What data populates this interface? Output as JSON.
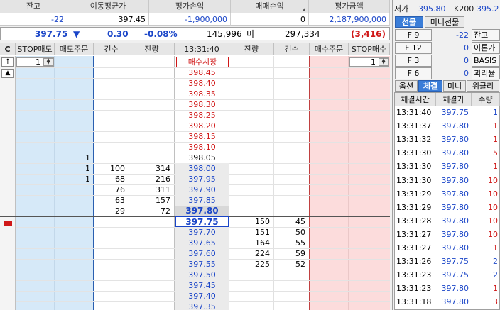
{
  "summary": {
    "headers": [
      "잔고",
      "이동평균가",
      "평가손익",
      "매매손익",
      "평가금액"
    ],
    "values": [
      "-22",
      "397.45",
      "-1,900,000",
      "0",
      "2,187,900,000"
    ]
  },
  "price_bar": {
    "price": "397.75",
    "arrow": "▼",
    "change": "0.30",
    "rate": "-0.08%",
    "volume": "145,996",
    "mi_label": "미",
    "open_int": "297,334",
    "diff": "(3,416)"
  },
  "orderbook": {
    "headers": {
      "c": "C",
      "stop_sell": "STOP매도",
      "sell_order": "매도주문",
      "sell_cnt": "건수",
      "sell_rem": "잔량",
      "time": "13:31:40",
      "buy_rem": "잔량",
      "buy_cnt": "건수",
      "buy_order": "매수주문",
      "stop_buy": "STOP매수"
    },
    "qty_left": "1",
    "qty_right": "1",
    "market_buy": "매수시장",
    "side_up": "↑",
    "side_tri": "▲",
    "ask_prices": [
      "398.45",
      "398.40",
      "398.35",
      "398.30",
      "398.25",
      "398.20",
      "398.15",
      "398.10",
      "398.05",
      "398.00",
      "397.95",
      "397.90",
      "397.85",
      "397.80"
    ],
    "ask_cnt": [
      "",
      "",
      "",
      "",
      "",
      "",
      "",
      "",
      "1",
      "1",
      "1",
      "",
      "",
      ""
    ],
    "ask_cnt2": [
      "",
      "",
      "",
      "",
      "",
      "",
      "",
      "",
      "",
      "100",
      "68",
      "76",
      "63",
      "29"
    ],
    "ask_rem": [
      "",
      "",
      "",
      "",
      "",
      "",
      "",
      "",
      "",
      "314",
      "216",
      "311",
      "157",
      "72"
    ],
    "bid_prices": [
      "397.75",
      "397.70",
      "397.65",
      "397.60",
      "397.55",
      "397.50",
      "397.45",
      "397.40",
      "397.35"
    ],
    "bid_rem": [
      "150",
      "151",
      "164",
      "224",
      "225",
      "",
      "",
      "",
      ""
    ],
    "bid_cnt": [
      "45",
      "50",
      "55",
      "59",
      "52",
      "",
      "",
      "",
      ""
    ]
  },
  "right": {
    "top_labels": [
      "저가",
      "395.80",
      "K200",
      "395.2"
    ],
    "tabs": [
      "선물",
      "미니선물"
    ],
    "futures": [
      {
        "k": "F 9",
        "v": "-22",
        "b": "잔고"
      },
      {
        "k": "F 12",
        "v": "0",
        "b": "이론가"
      },
      {
        "k": "F 3",
        "v": "0",
        "b": "BASIS"
      },
      {
        "k": "F 6",
        "v": "0",
        "b": "괴리율"
      }
    ],
    "subtabs": [
      "옵션",
      "체결",
      "미니",
      "위클리"
    ],
    "trade_headers": [
      "체결시간",
      "체결가",
      "수량"
    ],
    "trades": [
      {
        "t": "13:31:40",
        "p": "397.75",
        "q": "1"
      },
      {
        "t": "13:31:37",
        "p": "397.80",
        "q": "1"
      },
      {
        "t": "13:31:32",
        "p": "397.80",
        "q": "1"
      },
      {
        "t": "13:31:30",
        "p": "397.80",
        "q": "5"
      },
      {
        "t": "13:31:30",
        "p": "397.80",
        "q": "1"
      },
      {
        "t": "13:31:30",
        "p": "397.80",
        "q": "10"
      },
      {
        "t": "13:31:29",
        "p": "397.80",
        "q": "10"
      },
      {
        "t": "13:31:29",
        "p": "397.80",
        "q": "10"
      },
      {
        "t": "13:31:28",
        "p": "397.80",
        "q": "10"
      },
      {
        "t": "13:31:27",
        "p": "397.80",
        "q": "10"
      },
      {
        "t": "13:31:27",
        "p": "397.80",
        "q": "1"
      },
      {
        "t": "13:31:26",
        "p": "397.75",
        "q": "2"
      },
      {
        "t": "13:31:23",
        "p": "397.75",
        "q": "2"
      },
      {
        "t": "13:31:23",
        "p": "397.80",
        "q": "1"
      },
      {
        "t": "13:31:18",
        "p": "397.80",
        "q": "3"
      }
    ]
  },
  "colors": {
    "blue": "#1a45c8",
    "red": "#d01818",
    "ask_bg": "#d6e9f8",
    "bid_bg": "#fcdcdc",
    "price_ask_bg": "#fff3f3",
    "price_bid_bg": "#eef4fd"
  }
}
